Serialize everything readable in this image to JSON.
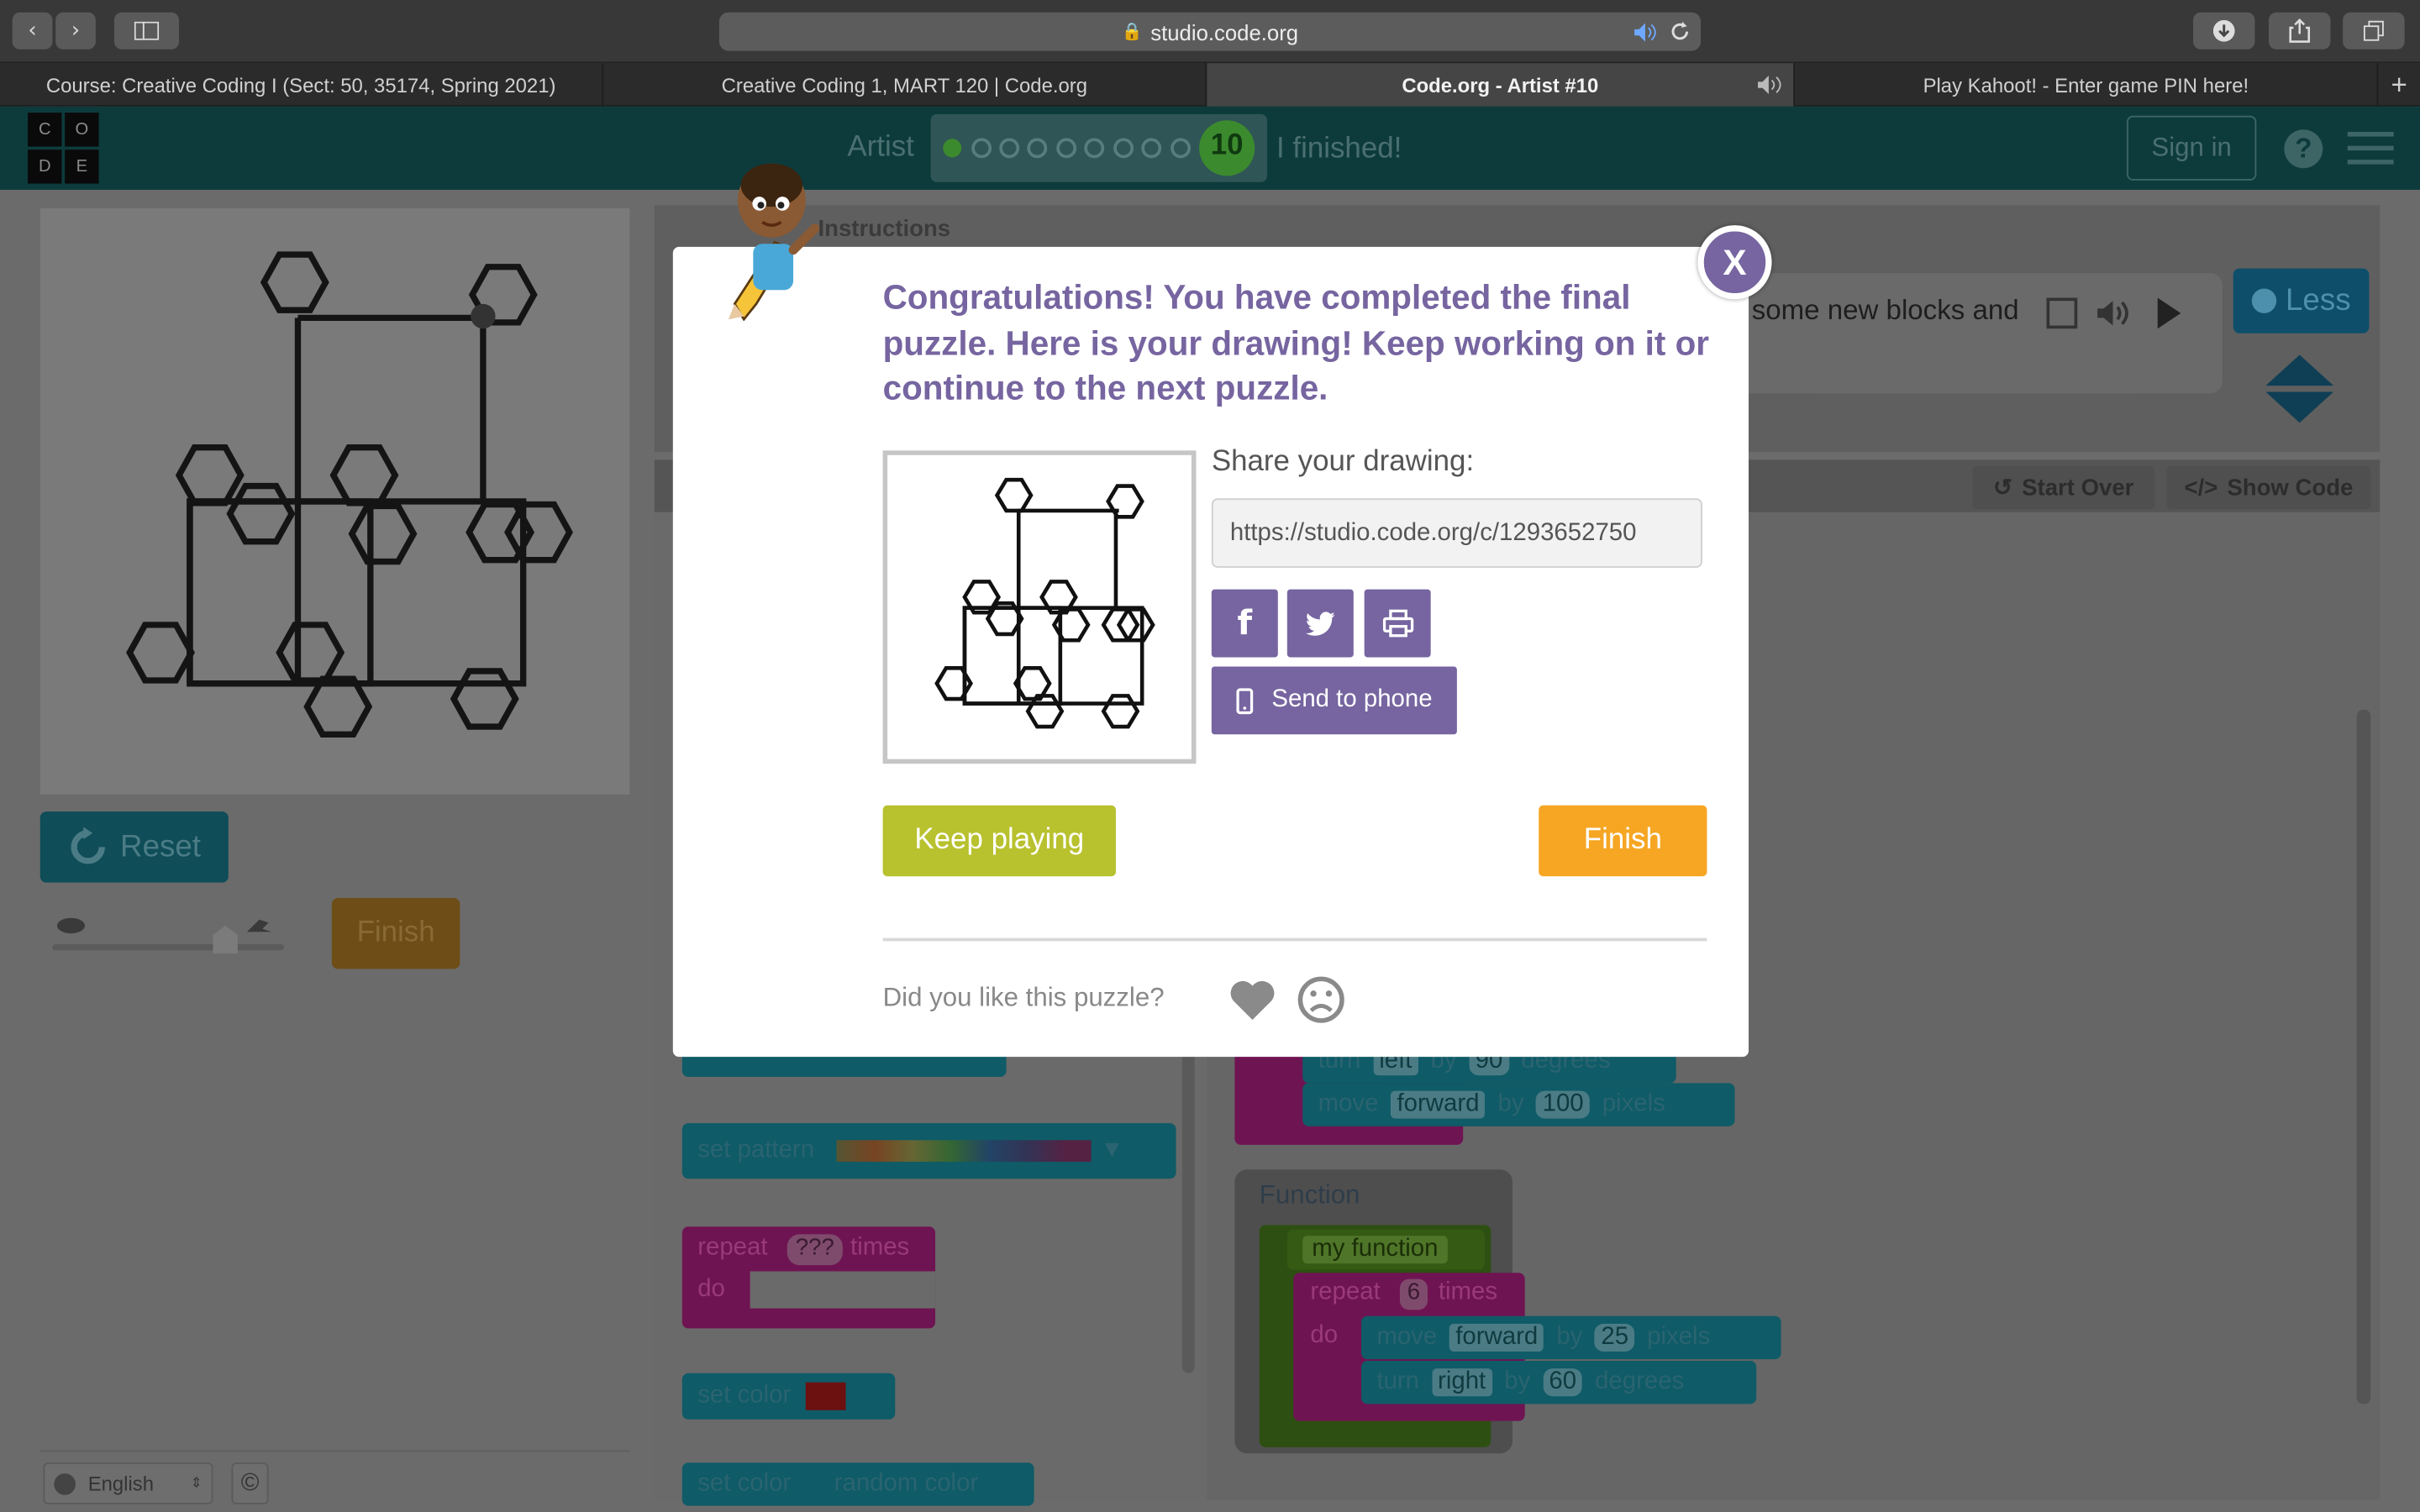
{
  "browser": {
    "url": "studio.code.org",
    "tabs": [
      "Course: Creative Coding I (Sect: 50, 35174, Spring 2021)",
      "Creative Coding 1, MART 120 | Code.org",
      "Code.org - Artist #10",
      "Play Kahoot! - Enter game PIN here!"
    ],
    "new_tab": "+"
  },
  "header": {
    "logo_letters": [
      "C",
      "O",
      "D",
      "E"
    ],
    "level_type": "Artist",
    "level_number": "10",
    "finished_label": "I finished!",
    "sign_in": "Sign in",
    "help": "?"
  },
  "instructions": {
    "label": "Instructions",
    "text": "some new blocks and",
    "less": "Less"
  },
  "workspace": {
    "start_over": "Start Over",
    "show_code": "Show Code"
  },
  "stage_controls": {
    "reset": "Reset",
    "finish": "Finish"
  },
  "toolbox": {
    "set_pattern": "set pattern",
    "repeat": "repeat",
    "repeat_count": "???",
    "times": "times",
    "do": "do",
    "set_color": "set color",
    "set_color2": "set color",
    "random_color": "random color"
  },
  "code": {
    "turn": "turn",
    "left": "left",
    "by": "by",
    "ninety": "90",
    "degrees": "degrees",
    "move": "move",
    "forward": "forward",
    "hundred": "100",
    "pixels": "pixels",
    "function_label": "Function",
    "my_function": "my function",
    "repeat": "repeat",
    "six": "6",
    "times": "times",
    "do": "do",
    "twentyfive": "25",
    "right": "right",
    "sixty": "60"
  },
  "footer": {
    "language": "English",
    "copyright": "©"
  },
  "modal": {
    "close": "X",
    "heading": "Congratulations! You have completed the final puzzle. Here is your drawing! Keep working on it or continue to the next puzzle.",
    "share_label": "Share your drawing:",
    "share_url": "https://studio.code.org/c/1293652750",
    "send_to_phone": "Send to phone",
    "keep_playing": "Keep playing",
    "finish": "Finish",
    "feedback": "Did you like this puzzle?"
  },
  "colors": {
    "accent": "#7665a0",
    "green": "#b8c12e",
    "orange": "#f6a623",
    "teal": "#0d3b3c"
  }
}
